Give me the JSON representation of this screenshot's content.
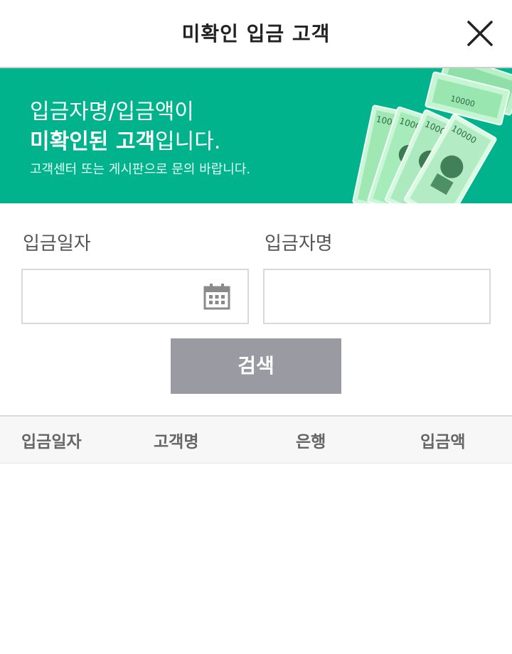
{
  "header": {
    "title": "미확인 입금 고객",
    "close_icon": "close-icon"
  },
  "banner": {
    "line1": "입금자명/입금액이",
    "line2_bold": "미확인된 고객",
    "line2_rest": "입니다.",
    "line3": "고객센터 또는 게시판으로 문의 바랍니다.",
    "background_color": "#00b38c",
    "image": "money-bills-icon"
  },
  "form": {
    "date_label": "입금일자",
    "date_value": "",
    "date_icon": "calendar-icon",
    "name_label": "입금자명",
    "name_value": ""
  },
  "search_button": {
    "label": "검색",
    "color": "#9a9aa2"
  },
  "table": {
    "columns": [
      "입금일자",
      "고객명",
      "은행",
      "입금액"
    ],
    "rows": []
  }
}
